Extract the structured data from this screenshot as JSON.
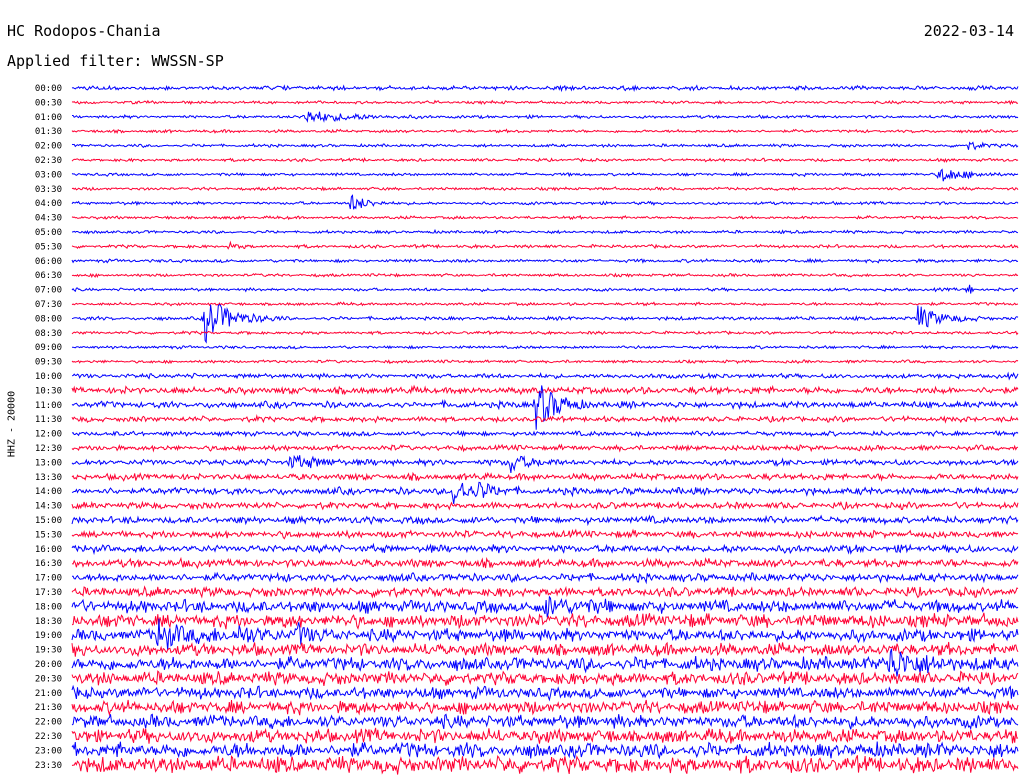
{
  "header": {
    "station": "HC Rodopos-Chania",
    "date": "2022-03-14",
    "filter": "Applied filter: WWSSN-SP"
  },
  "channel_label": "HHZ - 20000",
  "colors": {
    "even_trace": "#0000ff",
    "odd_trace": "#ff0033",
    "background": "#ffffff"
  },
  "chart_data": {
    "type": "line",
    "subtype": "helicorder",
    "title": "HC Rodopos-Chania",
    "date": "2022-03-14",
    "filter": "WWSSN-SP",
    "ylabel": "HHZ - 20000",
    "row_minutes": 30,
    "x_range_minutes": [
      0,
      30
    ],
    "rows": [
      "00:00",
      "00:30",
      "01:00",
      "01:30",
      "02:00",
      "02:30",
      "03:00",
      "03:30",
      "04:00",
      "04:30",
      "05:00",
      "05:30",
      "06:00",
      "06:30",
      "07:00",
      "07:30",
      "08:00",
      "08:30",
      "09:00",
      "09:30",
      "10:00",
      "10:30",
      "11:00",
      "11:30",
      "12:00",
      "12:30",
      "13:00",
      "13:30",
      "14:00",
      "14:30",
      "15:00",
      "15:30",
      "16:00",
      "16:30",
      "17:00",
      "17:30",
      "18:00",
      "18:30",
      "19:00",
      "19:30",
      "20:00",
      "20:30",
      "21:00",
      "21:30",
      "22:00",
      "22:30",
      "23:00",
      "23:30"
    ],
    "noise_level": [
      1.4,
      1.0,
      1.0,
      1.0,
      1.0,
      1.0,
      1.0,
      1.0,
      1.0,
      1.0,
      1.0,
      1.1,
      1.1,
      1.0,
      1.0,
      1.0,
      1.2,
      1.0,
      1.0,
      1.0,
      1.6,
      2.4,
      2.2,
      1.8,
      1.6,
      1.8,
      2.0,
      2.2,
      2.4,
      2.2,
      2.4,
      2.4,
      2.6,
      2.8,
      2.8,
      3.2,
      4.2,
      4.6,
      4.2,
      4.2,
      4.6,
      4.4,
      4.0,
      4.4,
      4.4,
      4.8,
      5.0,
      5.6
    ],
    "events": [
      {
        "row": "01:00",
        "minute": 7.3,
        "amplitude": 7,
        "duration_min": 1.5
      },
      {
        "row": "02:00",
        "minute": 28.4,
        "amplitude": 4,
        "duration_min": 0.6
      },
      {
        "row": "03:00",
        "minute": 27.5,
        "amplitude": 9,
        "duration_min": 0.8
      },
      {
        "row": "04:00",
        "minute": 8.8,
        "amplitude": 9,
        "duration_min": 0.6
      },
      {
        "row": "05:30",
        "minute": 5.0,
        "amplitude": 3,
        "duration_min": 0.3
      },
      {
        "row": "07:00",
        "minute": 28.4,
        "amplitude": 14,
        "duration_min": 0.1
      },
      {
        "row": "08:00",
        "minute": 4.2,
        "amplitude": 24,
        "duration_min": 0.9
      },
      {
        "row": "08:00",
        "minute": 26.8,
        "amplitude": 13,
        "duration_min": 0.8
      },
      {
        "row": "11:00",
        "minute": 14.7,
        "amplitude": 26,
        "duration_min": 0.7
      },
      {
        "row": "13:00",
        "minute": 6.9,
        "amplitude": 7,
        "duration_min": 1.0
      },
      {
        "row": "13:00",
        "minute": 13.9,
        "amplitude": 12,
        "duration_min": 0.5
      },
      {
        "row": "14:00",
        "minute": 12.1,
        "amplitude": 14,
        "duration_min": 0.6
      },
      {
        "row": "14:00",
        "minute": 12.9,
        "amplitude": 9,
        "duration_min": 0.4
      },
      {
        "row": "18:00",
        "minute": 15.0,
        "amplitude": 8,
        "duration_min": 1.2
      },
      {
        "row": "19:00",
        "minute": 2.7,
        "amplitude": 14,
        "duration_min": 1.0
      },
      {
        "row": "19:00",
        "minute": 5.3,
        "amplitude": 10,
        "duration_min": 0.5
      },
      {
        "row": "19:00",
        "minute": 7.1,
        "amplitude": 14,
        "duration_min": 0.4
      },
      {
        "row": "20:00",
        "minute": 25.9,
        "amplitude": 16,
        "duration_min": 1.0
      }
    ]
  }
}
